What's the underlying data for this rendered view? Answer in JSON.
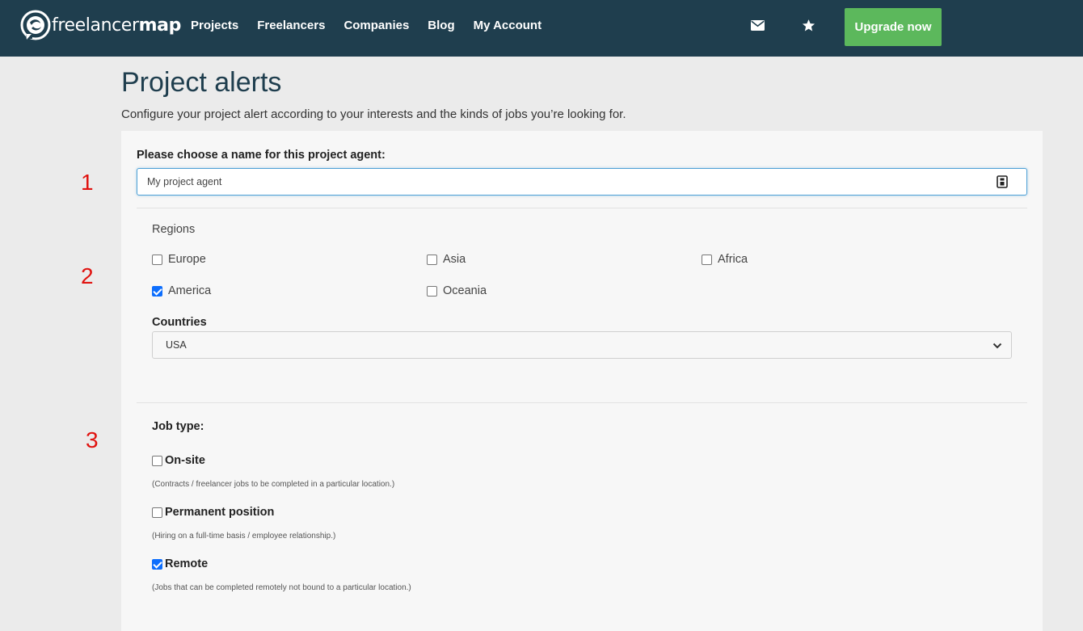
{
  "nav": {
    "logo_text_light": "freelancer",
    "logo_text_bold": "map",
    "links": [
      "Projects",
      "Freelancers",
      "Companies",
      "Blog",
      "My Account"
    ],
    "icons": [
      "envelope-icon",
      "star-icon"
    ],
    "upgrade_label": "Upgrade now",
    "upgrade_color": "#5cb85c",
    "bar_color": "#1f3e4e"
  },
  "page": {
    "title": "Project alerts",
    "subtitle": "Configure your project alert according to your interests and the kinds of jobs you’re looking for."
  },
  "annotations": [
    "1",
    "2",
    "3"
  ],
  "agent_name": {
    "label": "Please choose a name for this project agent:",
    "value": "My project agent"
  },
  "regions": {
    "label": "Regions",
    "options": [
      {
        "label": "Europe",
        "checked": false
      },
      {
        "label": "Asia",
        "checked": false
      },
      {
        "label": "Africa",
        "checked": false
      },
      {
        "label": "America",
        "checked": true
      },
      {
        "label": "Oceania",
        "checked": false
      }
    ]
  },
  "countries": {
    "label": "Countries",
    "selected": "USA"
  },
  "job_type": {
    "label": "Job type:",
    "options": [
      {
        "label": "On-site",
        "desc": "(Contracts / freelancer jobs to be completed in a particular location.)",
        "checked": false
      },
      {
        "label": "Permanent position",
        "desc": "(Hiring on a full-time basis / employee relationship.)",
        "checked": false
      },
      {
        "label": "Remote",
        "desc": "(Jobs that can be completed remotely not bound to a particular location.)",
        "checked": true
      }
    ]
  }
}
